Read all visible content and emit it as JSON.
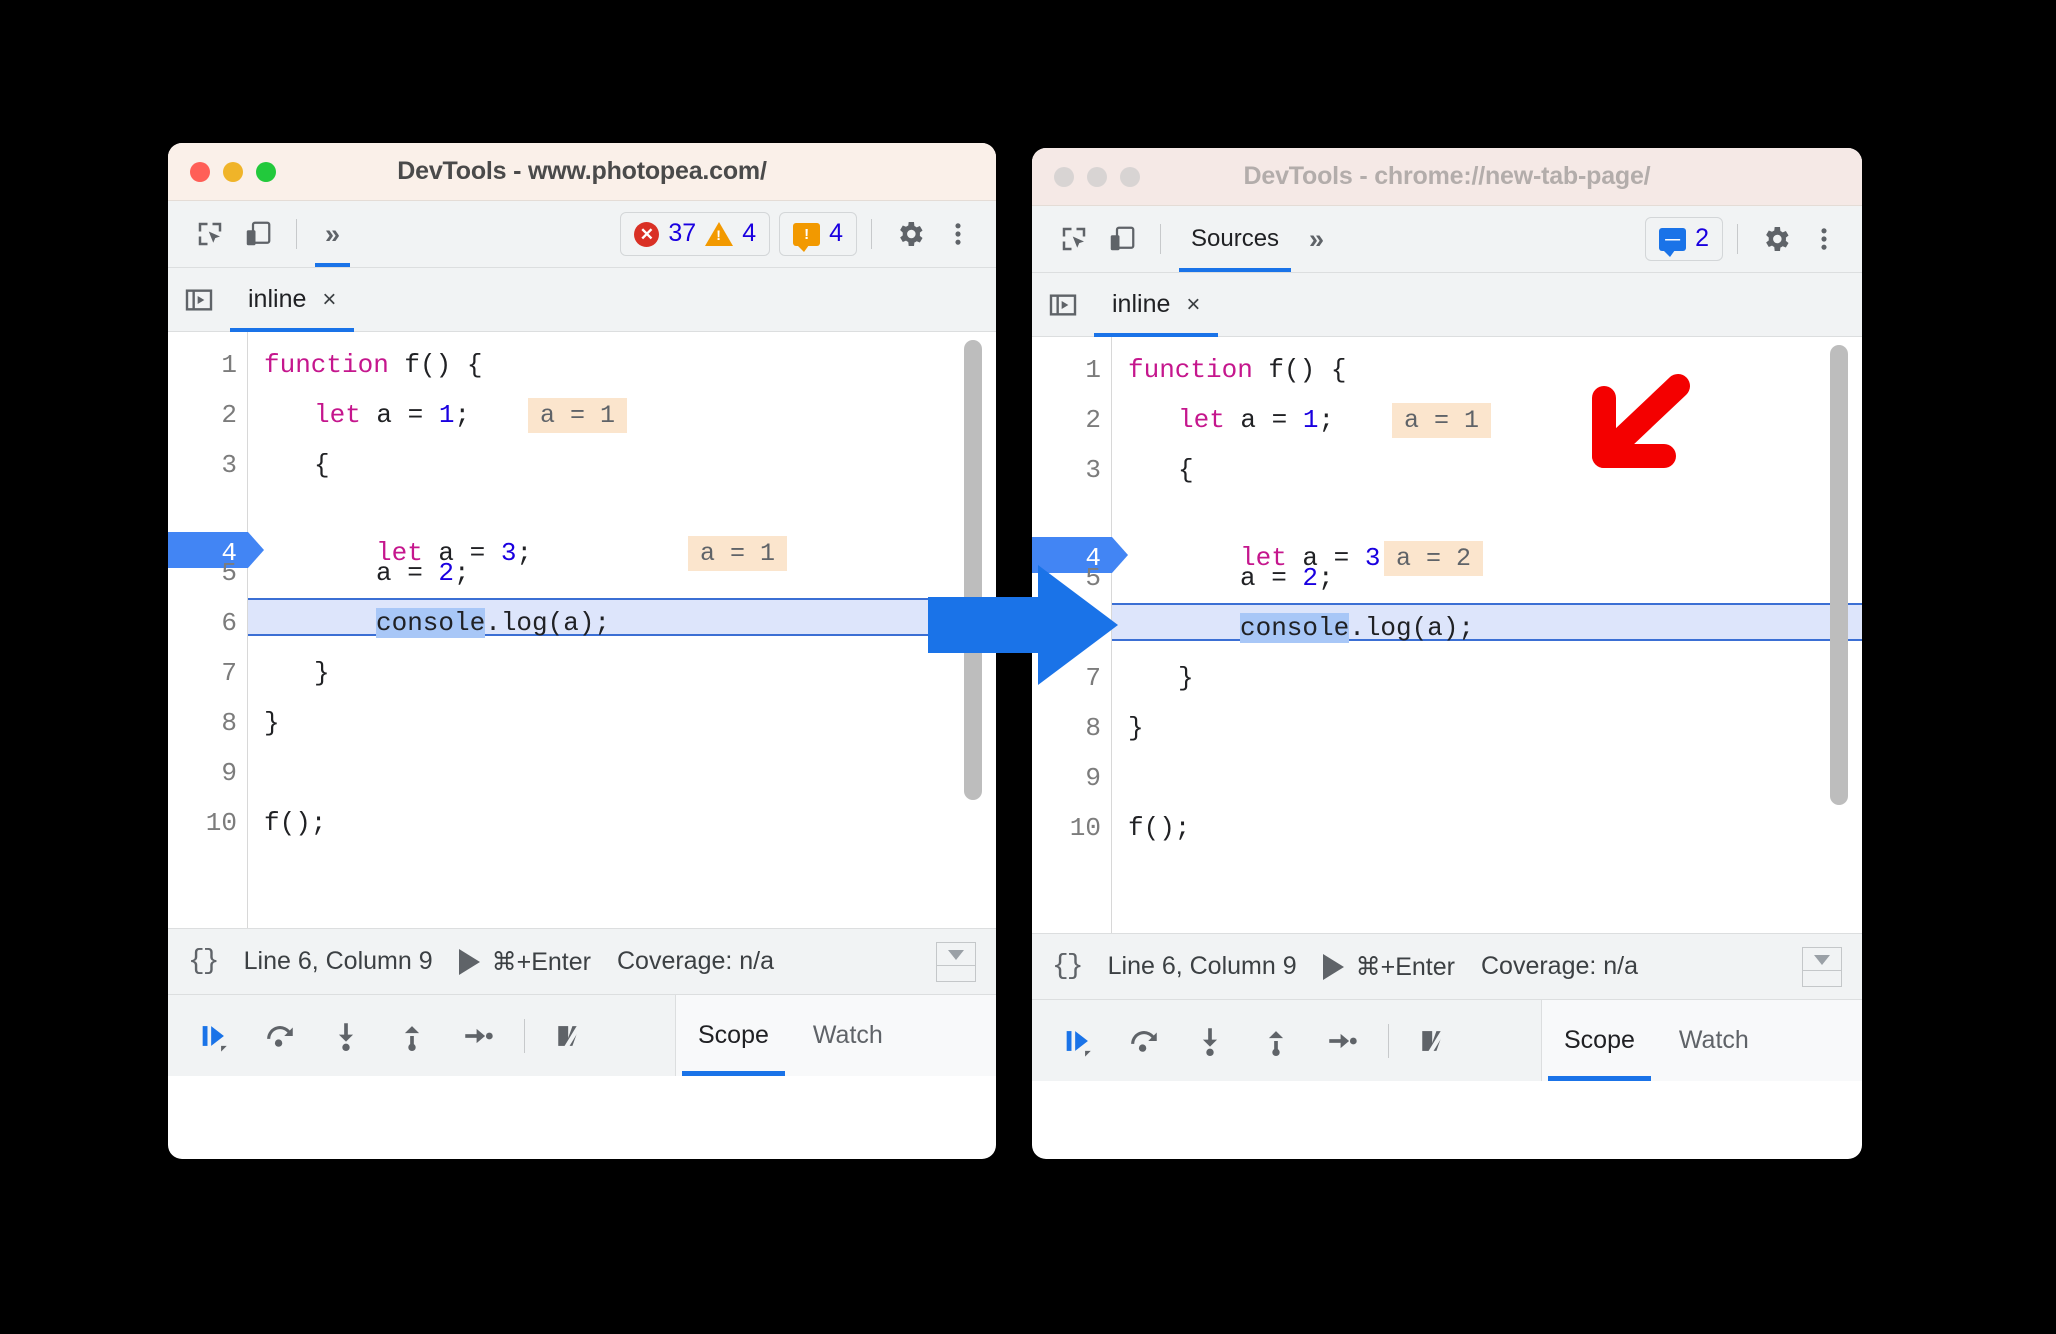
{
  "windows": [
    {
      "id": "left",
      "title": "DevTools - www.photopea.com/",
      "active": true,
      "toolbar": {
        "inspect_icon": "inspect-element-icon",
        "device_icon": "device-toolbar-icon",
        "more_tabs_label": "»",
        "panel_tab_label": "",
        "badges": [
          {
            "icon": "error-icon",
            "count": "37"
          },
          {
            "icon": "warning-icon",
            "count": "4"
          },
          {
            "icon": "message-icon",
            "count": "4"
          }
        ],
        "settings_icon": "gear-icon",
        "menu_icon": "three-dot-menu-icon"
      },
      "tabstrip": {
        "nav_icon": "show-navigator-icon",
        "file_name": "inline",
        "close_label": "×"
      },
      "code": {
        "lines": [
          "1",
          "2",
          "3",
          "4",
          "5",
          "6",
          "7",
          "8",
          "9",
          "10"
        ],
        "breakpoint_line": "4",
        "execution_line": "6",
        "pills": [
          {
            "text": "a = 1",
            "line": 2
          },
          {
            "text": "a = 1",
            "line": 4
          }
        ]
      },
      "status": {
        "braces_label": "{}",
        "position_label": "Line 6, Column 9",
        "run_shortcut": "⌘+Enter",
        "coverage_label": "Coverage: n/a",
        "drawer_icon": "show-drawer-icon"
      },
      "debug": {
        "buttons": [
          "resume-script-execution-icon",
          "step-over-next-function-call-icon",
          "step-into-next-function-call-icon",
          "step-out-of-current-function-icon",
          "step-icon",
          "deactivate-breakpoints-icon"
        ],
        "tabs": [
          {
            "label": "Scope",
            "active": true
          },
          {
            "label": "Watch",
            "active": false
          }
        ]
      }
    },
    {
      "id": "right",
      "title": "DevTools - chrome://new-tab-page/",
      "active": false,
      "toolbar": {
        "inspect_icon": "inspect-element-icon",
        "device_icon": "device-toolbar-icon",
        "panel_tab_label": "Sources",
        "more_tabs_label": "»",
        "badges": [
          {
            "icon": "message-icon",
            "count": "2"
          }
        ],
        "settings_icon": "gear-icon",
        "menu_icon": "three-dot-menu-icon"
      },
      "tabstrip": {
        "nav_icon": "show-navigator-icon",
        "file_name": "inline",
        "close_label": "×"
      },
      "code": {
        "lines": [
          "1",
          "2",
          "3",
          "4",
          "5",
          "6",
          "7",
          "8",
          "9",
          "10"
        ],
        "breakpoint_line": "4",
        "execution_line": "6",
        "pills": [
          {
            "text": "a = 1",
            "line": 2
          },
          {
            "text": "a = 2",
            "line": 4
          }
        ]
      },
      "status": {
        "braces_label": "{}",
        "position_label": "Line 6, Column 9",
        "run_shortcut": "⌘+Enter",
        "coverage_label": "Coverage: n/a",
        "drawer_icon": "show-drawer-icon"
      },
      "debug": {
        "buttons": [
          "resume-script-execution-icon",
          "step-over-next-function-call-icon",
          "step-into-next-function-call-icon",
          "step-out-of-current-function-icon",
          "step-icon",
          "deactivate-breakpoints-icon"
        ],
        "tabs": [
          {
            "label": "Scope",
            "active": true
          },
          {
            "label": "Watch",
            "active": false
          }
        ]
      }
    }
  ],
  "source_code": {
    "line1_kw": "function",
    "line1_fn": " f() {",
    "line2_kw": "let",
    "line2_mid": " a = ",
    "line2_num": "1",
    "line2_end": ";",
    "line3": "{",
    "line4_kw": "let",
    "line4_mid": " a = ",
    "line4_num": "3",
    "line4_end": ";",
    "line5_pre": "a = ",
    "line5_num": "2",
    "line5_end": ";",
    "line6_sel": "console",
    "line6_rest": ".log(a);",
    "line7": "}",
    "line8": "}",
    "line10": "f();"
  },
  "annotations": {
    "blue_arrow": "transition-arrow",
    "red_arrow": "callout-arrow",
    "blue_arrow_color": "#1a73e8",
    "red_arrow_color": "#f40000"
  },
  "colors": {
    "accent": "#1a73e8",
    "breakpoint": "#4285f4",
    "error": "#d93025",
    "warning": "#f29900",
    "pill_bg": "#fbe5cd",
    "exec_line_bg": "#dde5fb",
    "keyword": "#c5168d",
    "number": "#1a00e0"
  }
}
